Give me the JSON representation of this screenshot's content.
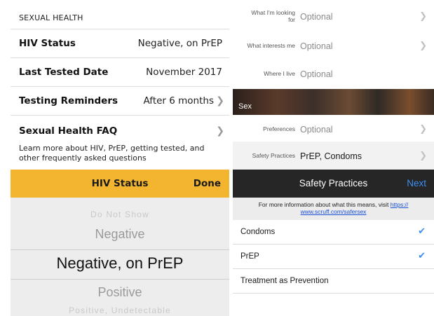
{
  "left": {
    "section_header": "SEXUAL HEALTH",
    "rows": [
      {
        "label": "HIV Status",
        "value": "Negative, on PrEP"
      },
      {
        "label": "Last Tested Date",
        "value": "November 2017"
      },
      {
        "label": "Testing Reminders",
        "value": "After 6 months"
      }
    ],
    "faq": {
      "label": "Sexual Health FAQ",
      "description": "Learn more about HIV, PrEP, getting tested, and other frequently asked questions"
    },
    "picker_bar": {
      "title": "HIV Status",
      "done_label": "Done"
    },
    "picker": {
      "options": [
        "Do Not Show",
        "Negative",
        "Negative, on PrEP",
        "Positive",
        "Positive, Undetectable"
      ],
      "selected": "Negative, on PrEP"
    }
  },
  "right": {
    "profile_rows": [
      {
        "label": "What I'm looking for",
        "value": "Optional"
      },
      {
        "label": "What interests me",
        "value": "Optional"
      },
      {
        "label": "Where I live",
        "value": "Optional"
      }
    ],
    "sex_header": "Sex",
    "sex_rows": [
      {
        "label": "Preferences",
        "value": "Optional"
      },
      {
        "label": "Safety Practices",
        "value": "PrEP, Condoms"
      }
    ],
    "dark_bar": {
      "title": "Safety Practices",
      "next_label": "Next"
    },
    "info": {
      "text": "For more information about what this means, visit",
      "link": "https:// www.scruff.com/safersex"
    },
    "options": [
      {
        "label": "Condoms",
        "checked": true
      },
      {
        "label": "PrEP",
        "checked": true
      },
      {
        "label": "Treatment as Prevention",
        "checked": false
      }
    ]
  },
  "colors": {
    "picker_bar": "#f3b530",
    "dark_bar": "#262626",
    "accent_blue": "#3b8ef0"
  },
  "icons": {
    "chevron": "chevron-right-icon",
    "check": "checkmark-icon"
  }
}
